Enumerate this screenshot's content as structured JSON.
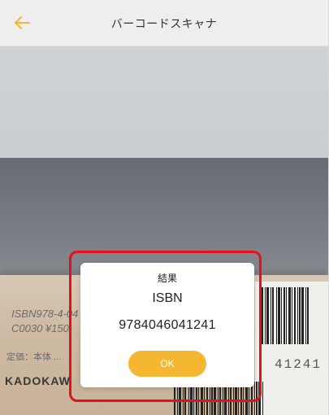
{
  "header": {
    "title": "バーコードスキャナ",
    "back_icon": "arrow-left-icon",
    "accent_color": "#f5b731"
  },
  "camera": {
    "book_lines": [
      "ISBN978-4-04",
      "C0030 ¥150",
      "定価：本体 ..."
    ],
    "publisher": "KADOKAW",
    "barcode_digits": "41241"
  },
  "dialog": {
    "title": "結果",
    "code_type": "ISBN",
    "code_value": "9784046041241",
    "ok_label": "OK",
    "highlight_color": "#e3111c"
  }
}
